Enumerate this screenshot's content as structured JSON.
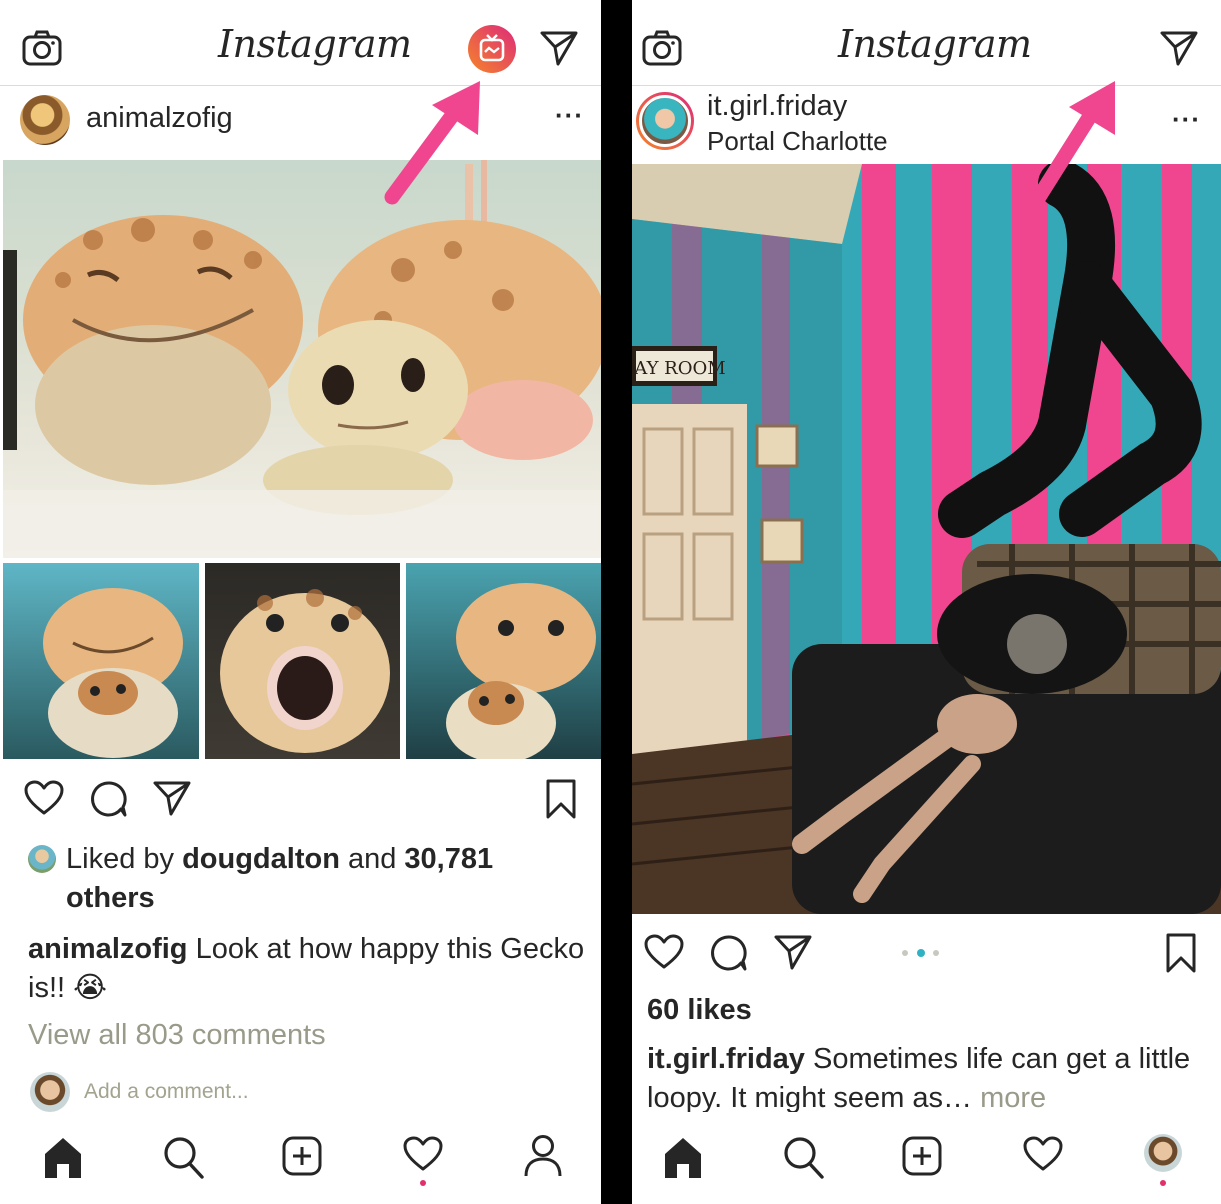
{
  "app": {
    "name": "Instagram"
  },
  "colors": {
    "accent_arrow": "#f0468f",
    "carousel_active": "#2fb2c4",
    "igtv_gradient_start": "#f58529",
    "igtv_gradient_end": "#dd2a7b"
  },
  "left": {
    "header": {
      "logo": "Instagram",
      "icons": [
        "camera-icon",
        "igtv-icon",
        "direct-message-icon"
      ]
    },
    "post": {
      "username": "animalzofig",
      "likes": {
        "prefix": "Liked by ",
        "user": "dougdalton",
        "middle": " and ",
        "count": "30,781",
        "suffix": "others"
      },
      "caption": {
        "user": "animalzofig",
        "text": " Look at how happy this Gecko is!! 😭"
      },
      "view_comments": "View all 803 comments",
      "add_comment_placeholder": "Add a comment..."
    },
    "nav": [
      "home-icon",
      "search-icon",
      "new-post-icon",
      "activity-icon",
      "profile-icon"
    ]
  },
  "right": {
    "header": {
      "logo": "Instagram",
      "icons": [
        "camera-icon",
        "direct-message-icon"
      ]
    },
    "post": {
      "username": "it.girl.friday",
      "location": "Portal Charlotte",
      "sign_text": "LAY ROOM",
      "likes": "60 likes",
      "caption": {
        "user": "it.girl.friday",
        "text": " Sometimes life can get a little loopy. It might seem as…",
        "more": " more"
      },
      "carousel": {
        "count": 3,
        "active": 2
      }
    },
    "nav": [
      "home-icon",
      "search-icon",
      "new-post-icon",
      "activity-icon",
      "profile-avatar"
    ]
  }
}
